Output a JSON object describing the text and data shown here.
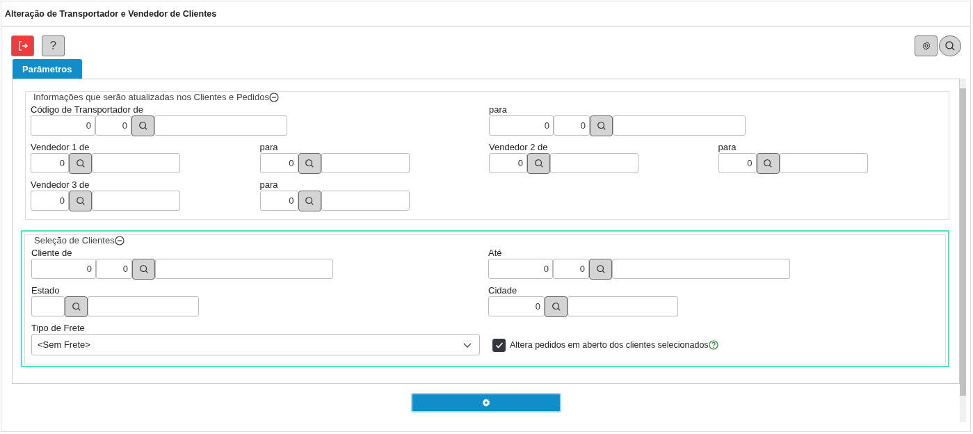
{
  "window": {
    "title": "Alteração de Transportador e Vendedor de Clientes"
  },
  "toolbar": {
    "help_label": "?"
  },
  "tabs": [
    {
      "label": "Parâmetros",
      "selected": true
    }
  ],
  "sections": [
    {
      "title": "Informações que serão atualizadas nos Clientes e Pedidos",
      "expanded": true,
      "highlighted": false,
      "fields": [
        {
          "kind": "code2",
          "label": "Código de Transportador de",
          "values": [
            "0",
            "0"
          ]
        },
        {
          "kind": "code2",
          "label": "para",
          "values": [
            "0",
            "0"
          ]
        },
        {
          "kind": "code1",
          "label": "Vendedor 1 de",
          "values": [
            "0"
          ]
        },
        {
          "kind": "code1",
          "label": "para",
          "values": [
            "0"
          ]
        },
        {
          "kind": "code1",
          "label": "Vendedor 2 de",
          "values": [
            "0"
          ]
        },
        {
          "kind": "code1",
          "label": "para",
          "values": [
            "0"
          ]
        },
        {
          "kind": "code1",
          "label": "Vendedor 3 de",
          "values": [
            "0"
          ]
        },
        {
          "kind": "code1",
          "label": "para",
          "values": [
            "0"
          ]
        }
      ]
    },
    {
      "title": "Seleção de Clientes",
      "expanded": true,
      "highlighted": true,
      "fields": [
        {
          "kind": "code2",
          "label": "Cliente de",
          "values": [
            "0",
            "0"
          ]
        },
        {
          "kind": "code2",
          "label": "Até",
          "values": [
            "0",
            "0"
          ]
        },
        {
          "kind": "text",
          "label": "Estado"
        },
        {
          "kind": "code1",
          "label": "Cidade",
          "values": [
            "0"
          ]
        },
        {
          "kind": "select",
          "label": "Tipo de Frete",
          "value": "<Sem Frete>"
        },
        {
          "kind": "checkbox",
          "label": "Altera pedidos em aberto dos clientes selecionados",
          "checked": true
        }
      ]
    }
  ]
}
